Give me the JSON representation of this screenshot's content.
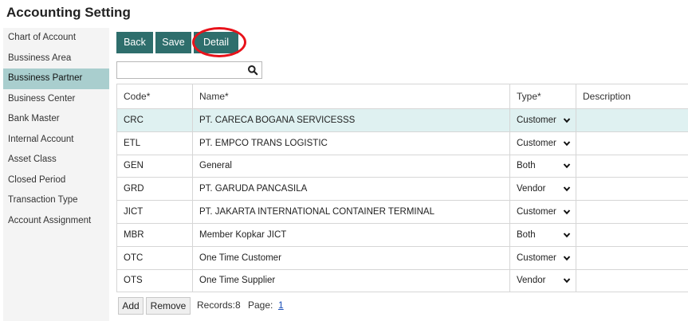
{
  "page": {
    "title": "Accounting Setting"
  },
  "sidebar": {
    "items": [
      {
        "label": "Chart of Account"
      },
      {
        "label": "Bussiness Area"
      },
      {
        "label": "Bussiness Partner",
        "active": true
      },
      {
        "label": "Business Center"
      },
      {
        "label": "Bank Master"
      },
      {
        "label": "Internal Account"
      },
      {
        "label": "Asset Class"
      },
      {
        "label": "Closed Period"
      },
      {
        "label": "Transaction Type"
      },
      {
        "label": "Account Assignment"
      }
    ]
  },
  "toolbar": {
    "back_label": "Back",
    "save_label": "Save",
    "detail_label": "Detail"
  },
  "search": {
    "value": "",
    "placeholder": "",
    "icon": "search-icon"
  },
  "table": {
    "headers": {
      "code": "Code*",
      "name": "Name*",
      "type": "Type*",
      "description": "Description"
    },
    "rows": [
      {
        "code": "CRC",
        "name": "PT. CARECA BOGANA SERVICESSS",
        "type": "Customer",
        "description": ""
      },
      {
        "code": "ETL",
        "name": "PT. EMPCO TRANS LOGISTIC",
        "type": "Customer",
        "description": ""
      },
      {
        "code": "GEN",
        "name": "General",
        "type": "Both",
        "description": ""
      },
      {
        "code": "GRD",
        "name": "PT. GARUDA PANCASILA",
        "type": "Vendor",
        "description": ""
      },
      {
        "code": "JICT",
        "name": "PT. JAKARTA INTERNATIONAL CONTAINER TERMINAL",
        "type": "Customer",
        "description": ""
      },
      {
        "code": "MBR",
        "name": "Member Kopkar JICT",
        "type": "Both",
        "description": ""
      },
      {
        "code": "OTC",
        "name": "One Time Customer",
        "type": "Customer",
        "description": ""
      },
      {
        "code": "OTS",
        "name": "One Time Supplier",
        "type": "Vendor",
        "description": ""
      }
    ],
    "selected_row": 0
  },
  "footer": {
    "add_label": "Add",
    "remove_label": "Remove",
    "records_text": "Records:8",
    "page_label": "Page:",
    "page_link": "1"
  },
  "colors": {
    "button_bg": "#2e6e6c",
    "sidebar_active": "#a9cece",
    "selected_row": "#dff1f1",
    "annotation": "#e8121a",
    "link": "#1b4fb8"
  }
}
